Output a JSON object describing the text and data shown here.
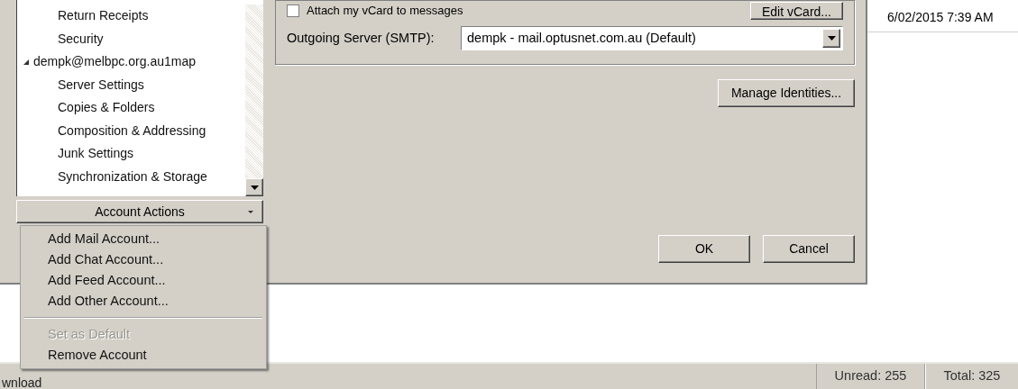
{
  "dialog": {
    "attach_vcard": {
      "label": "Attach my vCard to messages",
      "checked": false
    },
    "edit_vcard_button": "Edit vCard...",
    "outgoing_server": {
      "label": "Outgoing Server (SMTP):",
      "value": "dempk - mail.optusnet.com.au (Default)"
    },
    "manage_identities_button": "Manage Identities...",
    "buttons": [
      "OK",
      "Cancel"
    ]
  },
  "account_tree": [
    {
      "label": "Return Receipts"
    },
    {
      "label": "Security"
    },
    {
      "label": "dempk@melbpc.org.au1map",
      "expanded": true,
      "children": [
        {
          "label": "Server Settings"
        },
        {
          "label": "Copies & Folders"
        },
        {
          "label": "Composition & Addressing"
        },
        {
          "label": "Junk Settings"
        },
        {
          "label": "Synchronization & Storage"
        }
      ]
    }
  ],
  "account_actions": {
    "label": "Account Actions",
    "menu": [
      {
        "kind": "item",
        "label": "Add Mail Account...",
        "disabled": false
      },
      {
        "kind": "item",
        "label": "Add Chat Account...",
        "disabled": false
      },
      {
        "kind": "item",
        "label": "Add Feed Account...",
        "disabled": false
      },
      {
        "kind": "item",
        "label": "Add Other Account...",
        "disabled": false
      },
      {
        "kind": "separator"
      },
      {
        "kind": "item",
        "label": "Set as Default",
        "disabled": true
      },
      {
        "kind": "item",
        "label": "Remove Account",
        "disabled": false
      }
    ]
  },
  "message_date": "6/02/2015 7:39 AM",
  "status_bar": {
    "text": "wnload",
    "unread": "Unread: 255",
    "total": "Total: 325"
  }
}
